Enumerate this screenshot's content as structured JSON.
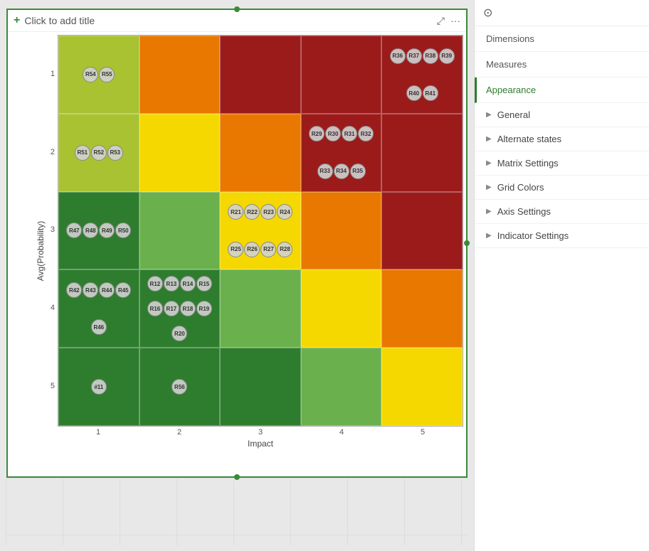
{
  "chart": {
    "title_placeholder": "Click to add title",
    "title_icon": "+",
    "x_axis_label": "Impact",
    "y_axis_label": "Avg(Probability)",
    "x_ticks": [
      "1",
      "2",
      "3",
      "4",
      "5"
    ],
    "y_ticks": [
      "1",
      "2",
      "3",
      "4",
      "5"
    ],
    "expand_icon": "⤢",
    "more_icon": "···"
  },
  "matrix": {
    "cells": [
      {
        "row": 5,
        "col": 1,
        "color": "c-yellow-green",
        "items": [
          "R54",
          "R55"
        ]
      },
      {
        "row": 5,
        "col": 2,
        "color": "c-orange",
        "items": []
      },
      {
        "row": 5,
        "col": 3,
        "color": "c-dark-red",
        "items": []
      },
      {
        "row": 5,
        "col": 4,
        "color": "c-dark-red",
        "items": []
      },
      {
        "row": 5,
        "col": 5,
        "color": "c-dark-red",
        "items": [
          "R36",
          "R37",
          "R38",
          "R39",
          "R40",
          "R41"
        ]
      },
      {
        "row": 4,
        "col": 1,
        "color": "c-yellow-green",
        "items": [
          "R51",
          "R52",
          "R53"
        ]
      },
      {
        "row": 4,
        "col": 2,
        "color": "c-yellow",
        "items": []
      },
      {
        "row": 4,
        "col": 3,
        "color": "c-orange",
        "items": []
      },
      {
        "row": 4,
        "col": 4,
        "color": "c-dark-red",
        "items": [
          "R29",
          "R30",
          "R31",
          "R32",
          "R33",
          "R34",
          "R35"
        ]
      },
      {
        "row": 4,
        "col": 5,
        "color": "c-dark-red",
        "items": []
      },
      {
        "row": 3,
        "col": 1,
        "color": "c-green",
        "items": [
          "R47",
          "R48",
          "R49",
          "R50"
        ]
      },
      {
        "row": 3,
        "col": 2,
        "color": "c-light-green",
        "items": []
      },
      {
        "row": 3,
        "col": 3,
        "color": "c-yellow",
        "items": [
          "R21",
          "R22",
          "R23",
          "R24",
          "R25",
          "R26",
          "R27",
          "R28"
        ]
      },
      {
        "row": 3,
        "col": 4,
        "color": "c-orange",
        "items": []
      },
      {
        "row": 3,
        "col": 5,
        "color": "c-dark-red",
        "items": []
      },
      {
        "row": 2,
        "col": 1,
        "color": "c-green",
        "items": [
          "R42",
          "R43",
          "R44",
          "R45",
          "R46"
        ]
      },
      {
        "row": 2,
        "col": 2,
        "color": "c-green",
        "items": [
          "R12",
          "R13",
          "R14",
          "R15",
          "R16",
          "R17",
          "R18",
          "R19",
          "R20"
        ]
      },
      {
        "row": 2,
        "col": 3,
        "color": "c-light-green",
        "items": []
      },
      {
        "row": 2,
        "col": 4,
        "color": "c-yellow",
        "items": []
      },
      {
        "row": 2,
        "col": 5,
        "color": "c-orange",
        "items": []
      },
      {
        "row": 1,
        "col": 1,
        "color": "c-green",
        "items": [
          "#11"
        ]
      },
      {
        "row": 1,
        "col": 2,
        "color": "c-green",
        "items": [
          "R56"
        ]
      },
      {
        "row": 1,
        "col": 3,
        "color": "c-green",
        "items": []
      },
      {
        "row": 1,
        "col": 4,
        "color": "c-light-green",
        "items": []
      },
      {
        "row": 1,
        "col": 5,
        "color": "c-yellow",
        "items": []
      }
    ]
  },
  "sidebar": {
    "nav_items": [
      {
        "label": "Dimensions",
        "active": false
      },
      {
        "label": "Measures",
        "active": false
      },
      {
        "label": "Appearance",
        "active": true
      }
    ],
    "sections": [
      {
        "label": "General"
      },
      {
        "label": "Alternate states"
      },
      {
        "label": "Matrix Settings"
      },
      {
        "label": "Grid Colors"
      },
      {
        "label": "Axis Settings"
      },
      {
        "label": "Indicator Settings"
      }
    ]
  }
}
